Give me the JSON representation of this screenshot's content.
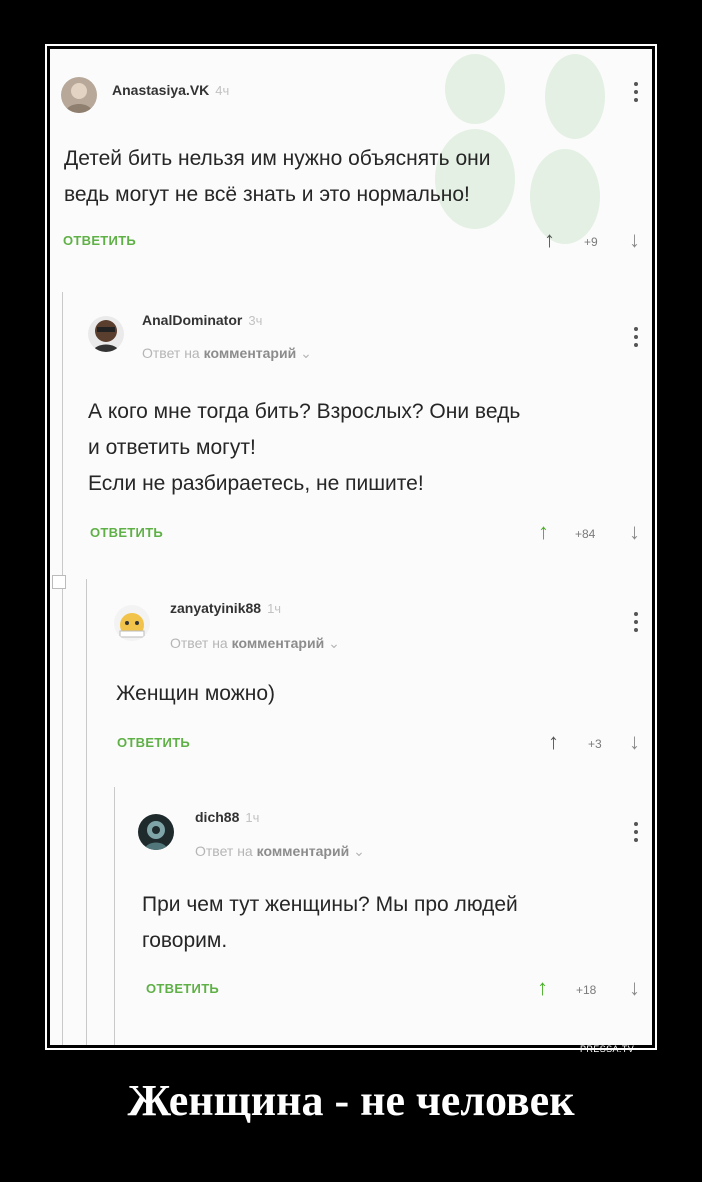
{
  "comments": [
    {
      "author": "Anastasiya.VK",
      "time": "4ч",
      "lines": [
        "Детей бить нельзя им нужно объяснять они",
        "ведь могут не всё знать и это нормально!"
      ],
      "reply_label": "ОТВЕТИТЬ",
      "rating": "+9"
    },
    {
      "author": "AnalDominator",
      "time": "3ч",
      "reply_to_prefix": "Ответ на",
      "reply_to_target": "комментарий",
      "lines": [
        "А кого мне тогда бить? Взрослых? Они ведь",
        "и ответить могут!",
        "Если не разбираетесь, не пишите!"
      ],
      "reply_label": "ОТВЕТИТЬ",
      "rating": "+84"
    },
    {
      "author": "zanyatyinik88",
      "time": "1ч",
      "reply_to_prefix": "Ответ на",
      "reply_to_target": "комментарий",
      "lines": [
        "Женщин можно)"
      ],
      "reply_label": "ОТВЕТИТЬ",
      "rating": "+3"
    },
    {
      "author": "dich88",
      "time": "1ч",
      "reply_to_prefix": "Ответ на",
      "reply_to_target": "комментарий",
      "lines": [
        "При чем тут женщины? Мы про людей",
        "говорим."
      ],
      "reply_label": "ОТВЕТИТЬ",
      "rating": "+18"
    }
  ],
  "watermark": "PRESSA.TV",
  "caption": "Женщина - не человек",
  "colors": {
    "accent": "#5fb046",
    "background": "#000000"
  }
}
